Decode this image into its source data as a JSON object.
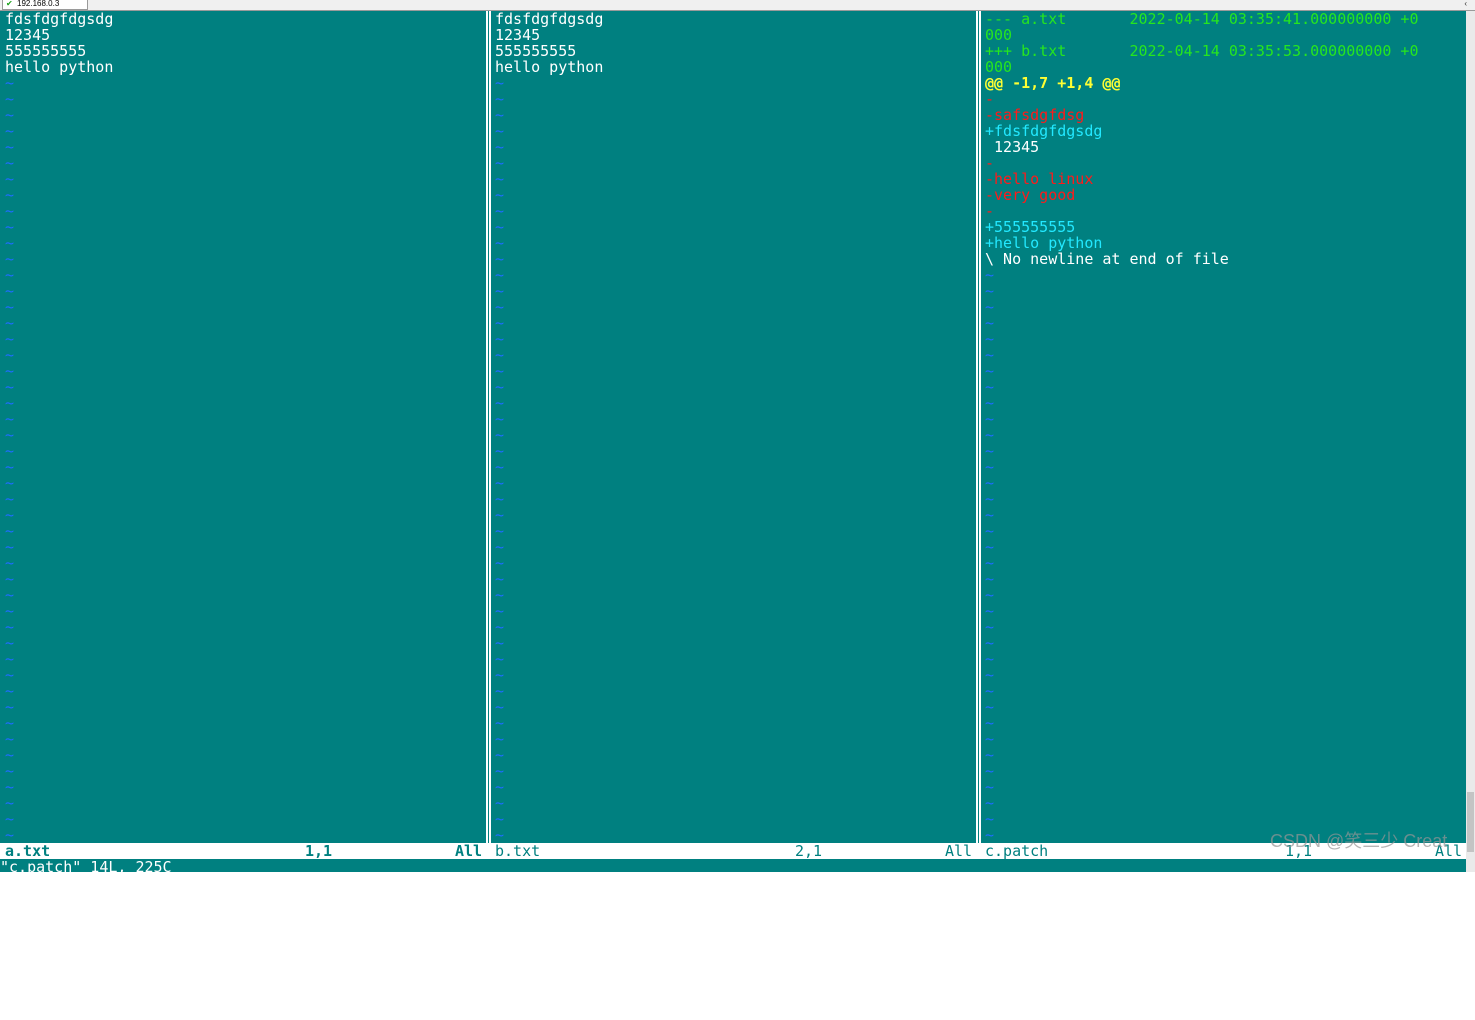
{
  "session_tab": {
    "title": "192.168.0.3"
  },
  "left_pane": {
    "lines": [
      "fdsfdgfdgsdg",
      "12345",
      "555555555",
      "hello python"
    ],
    "tilde_count": 48
  },
  "middle_pane": {
    "lines": [
      "fdsfdgfdgsdg",
      "12345",
      "555555555",
      "hello python"
    ],
    "tilde_count": 48
  },
  "right_pane": {
    "lines": [
      {
        "text": "--- a.txt\t2022-04-14 03:35:41.000000000 +0",
        "color": "green"
      },
      {
        "text": "000",
        "color": "green"
      },
      {
        "text": "+++ b.txt\t2022-04-14 03:35:53.000000000 +0",
        "color": "green"
      },
      {
        "text": "000",
        "color": "green"
      },
      {
        "text": "@@ -1,7 +1,4 @@",
        "color": "yellow"
      },
      {
        "text": "-",
        "color": "red"
      },
      {
        "text": "-safsdgfdsg",
        "color": "red"
      },
      {
        "text": "+fdsfdgfdgsdg",
        "color": "cyan"
      },
      {
        "text": " 12345",
        "color": "white"
      },
      {
        "text": "-",
        "color": "red"
      },
      {
        "text": "-hello linux",
        "color": "red"
      },
      {
        "text": "-very good",
        "color": "red"
      },
      {
        "text": "-",
        "color": "red"
      },
      {
        "text": "+555555555",
        "color": "cyan"
      },
      {
        "text": "+hello python",
        "color": "cyan"
      },
      {
        "text": "\\ No newline at end of file",
        "color": "white"
      }
    ],
    "tilde_count": 36
  },
  "status": {
    "left_file": "a.txt",
    "left_pos": "1,1",
    "left_scroll": "All",
    "middle_file": "b.txt",
    "middle_pos": "2,1",
    "middle_scroll": "All",
    "right_file": "c.patch",
    "right_pos": "1,1",
    "right_scroll": "All"
  },
  "command_line": "\"c.patch\" 14L, 225C",
  "watermark": "CSDN @笑三少 Creat",
  "colors": {
    "background": "#008080",
    "tilde": "#1e6cff",
    "diff_header": "#26e61e",
    "hunk": "#ffff33",
    "removed": "#ff1a1a",
    "added": "#22e8ff"
  }
}
